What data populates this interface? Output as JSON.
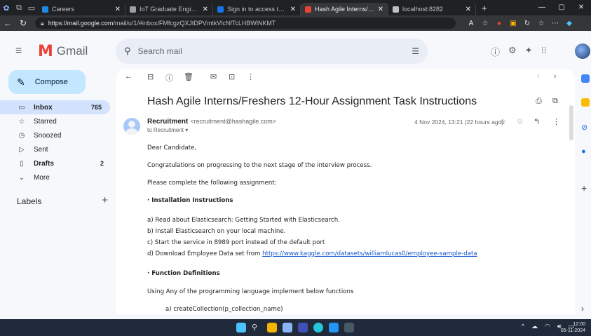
{
  "browser": {
    "tabs": [
      {
        "label": "Careers",
        "color": "#1e88e5"
      },
      {
        "label": "IoT Graduate Engineer Pos",
        "color": "#9aa0a6"
      },
      {
        "label": "Sign in to access this netw",
        "color": "#1a73e8"
      },
      {
        "label": "Hash Agile Interns/Fresher",
        "color": "#ea4335"
      },
      {
        "label": "localhost:8282",
        "color": "#bdc1c6"
      }
    ],
    "active_tab": 3,
    "url_host": "https://mail.google.com",
    "url_path": "/mail/u/1/#inbox/FMfcgzQXJtDPVmtkVlcNfTcLHBWlNKMT"
  },
  "gmail": {
    "app_name": "Gmail",
    "search_placeholder": "Search mail",
    "compose_label": "Compose",
    "nav": [
      {
        "icon": "inbox-icon",
        "glyph": "▭",
        "label": "Inbox",
        "count": "765",
        "bold": true,
        "selected": true
      },
      {
        "icon": "star-icon",
        "glyph": "☆",
        "label": "Starred",
        "count": "",
        "bold": false,
        "selected": false
      },
      {
        "icon": "clock-icon",
        "glyph": "◷",
        "label": "Snoozed",
        "count": "",
        "bold": false,
        "selected": false
      },
      {
        "icon": "send-icon",
        "glyph": "▷",
        "label": "Sent",
        "count": "",
        "bold": false,
        "selected": false
      },
      {
        "icon": "draft-icon",
        "glyph": "▯",
        "label": "Drafts",
        "count": "2",
        "bold": true,
        "selected": false
      },
      {
        "icon": "chevron-down-icon",
        "glyph": "⌄",
        "label": "More",
        "count": "",
        "bold": false,
        "selected": false
      }
    ],
    "labels_title": "Labels"
  },
  "message": {
    "subject": "Hash Agile Interns/Freshers 12-Hour Assignment Task Instructions",
    "sender_name": "Recruitment",
    "sender_email": "<recruitment@hashagile.com>",
    "to": "to Recruitment",
    "date": "4 Nov 2024, 13:21 (22 hours ago)",
    "body": [
      {
        "text": "Dear Candidate,",
        "bold": false
      },
      {
        "text": "Congratulations on progressing to the next stage of the interview process.",
        "bold": false
      },
      {
        "text": "Please complete the following assignment:",
        "bold": false
      },
      {
        "text": "· Installation Instructions",
        "bold": true
      },
      {
        "text": "a) Read about Elasticsearch: Getting Started with Elasticsearch.",
        "bold": false
      },
      {
        "text": "b) Install Elasticsearch on your local machine.",
        "bold": false
      },
      {
        "text": "c) Start the service in 8989 port instead of the default port",
        "bold": false
      },
      {
        "text": "d) Download Employee Data set from ",
        "bold": false,
        "link": "https://www.kaggle.com/datasets/williamlucas0/employee-sample-data"
      },
      {
        "text": "· Function Definitions",
        "bold": true
      },
      {
        "text": "Using Any of the programming language implement below functions",
        "bold": false
      },
      {
        "text": "a) createCollection(p_collection_name)",
        "bold": false,
        "indent": true
      }
    ]
  },
  "taskbar": {
    "time": "12:00",
    "date": "05-11-2024"
  }
}
